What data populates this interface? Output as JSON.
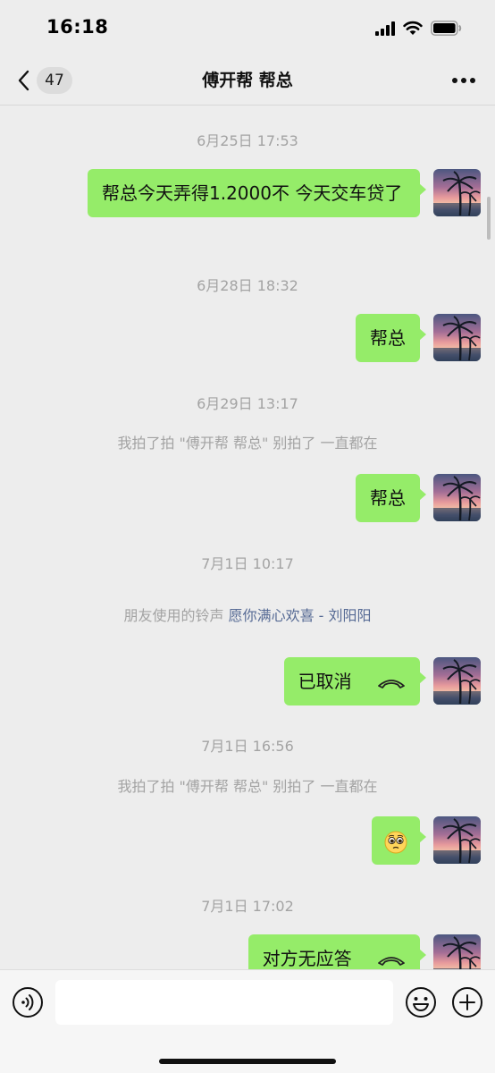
{
  "status_bar": {
    "time": "16:18"
  },
  "header": {
    "back_count": "47",
    "title": "傅开帮 帮总"
  },
  "messages": [
    {
      "type": "timestamp",
      "text": "6月25日 17:53"
    },
    {
      "type": "bubble",
      "text": "帮总今天弄得1.2000不 今天交车贷了"
    },
    {
      "type": "timestamp",
      "text": "6月28日 18:32"
    },
    {
      "type": "bubble",
      "text": "帮总"
    },
    {
      "type": "timestamp",
      "text": "6月29日 13:17"
    },
    {
      "type": "system",
      "text": "我拍了拍 \"傅开帮 帮总\" 别拍了 一直都在"
    },
    {
      "type": "bubble",
      "text": "帮总"
    },
    {
      "type": "timestamp",
      "text": "7月1日 10:17"
    },
    {
      "type": "ringtone",
      "prefix": "朋友使用的铃声 ",
      "link": "愿你满心欢喜 - 刘阳阳"
    },
    {
      "type": "call",
      "text": "已取消",
      "icon": "phone-handset-icon"
    },
    {
      "type": "timestamp",
      "text": "7月1日 16:56"
    },
    {
      "type": "system",
      "text": "我拍了拍 \"傅开帮 帮总\" 别拍了 一直都在"
    },
    {
      "type": "emoji",
      "icon": "pleading-face-icon"
    },
    {
      "type": "timestamp",
      "text": "7月1日 17:02"
    },
    {
      "type": "call",
      "text": "对方无应答",
      "icon": "phone-handset-icon"
    }
  ],
  "input_bar": {
    "placeholder": ""
  },
  "colors": {
    "bubble": "#95ec69",
    "background": "#ededed",
    "link": "#576b95",
    "meta_text": "#a3a3a3"
  }
}
